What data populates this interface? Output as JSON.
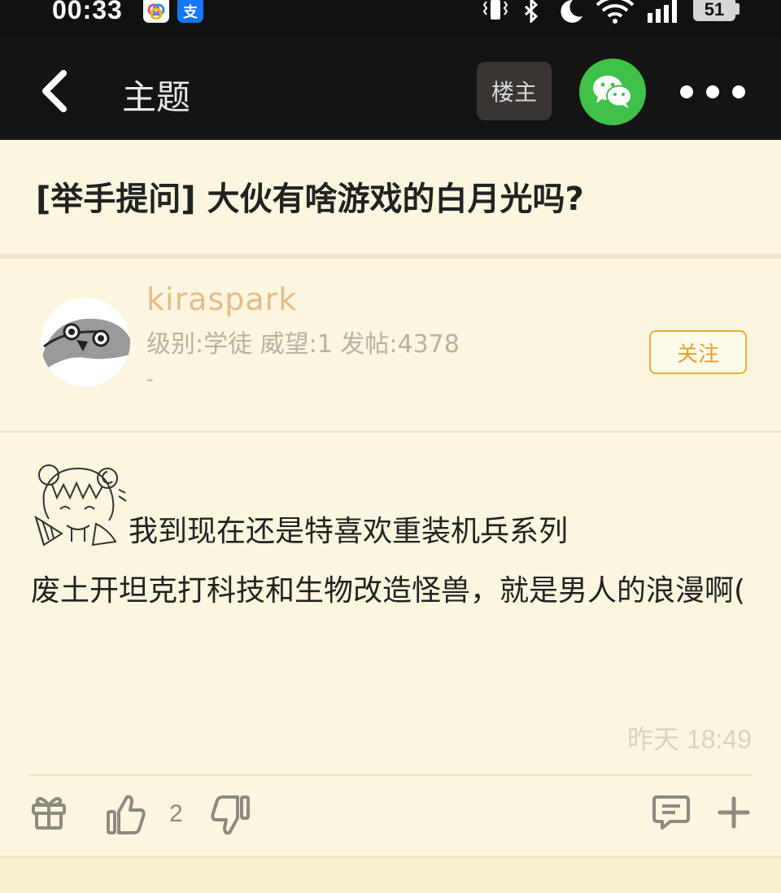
{
  "status_bar": {
    "time": "00:33",
    "alipay_glyph": "支",
    "battery": "51",
    "icons": [
      "vibrate-icon",
      "bluetooth-icon",
      "moon-icon",
      "wifi-icon",
      "signal-5g-icon"
    ]
  },
  "nav": {
    "title": "主题",
    "op_label": "楼主",
    "back_icon": "chevron-left-icon",
    "share_icon": "wechat-icon",
    "more_icon": "more-dots-icon"
  },
  "topic": {
    "title": "[举手提问] 大伙有啥游戏的白月光吗?"
  },
  "author": {
    "name": "kiraspark",
    "meta": "级别:学徒 威望:1 发帖:4378",
    "signature": "-",
    "follow_label": "关注"
  },
  "post": {
    "line1": "我到现在还是特喜欢重装机兵系列",
    "body": "废土开坦克打科技和生物改造怪兽，就是男人的浪漫啊(",
    "time": "昨天 18:49"
  },
  "actions": {
    "like_count": "2",
    "icons": [
      "gift-icon",
      "thumbs-up-icon",
      "thumbs-down-icon",
      "comment-icon",
      "plus-icon"
    ]
  },
  "colors": {
    "page_bg": "#fcf6e0",
    "nav_bg": "#141414",
    "accent_orange": "#e9ad34",
    "author_name": "#e7bd86",
    "wechat_green": "#3fc14a"
  }
}
